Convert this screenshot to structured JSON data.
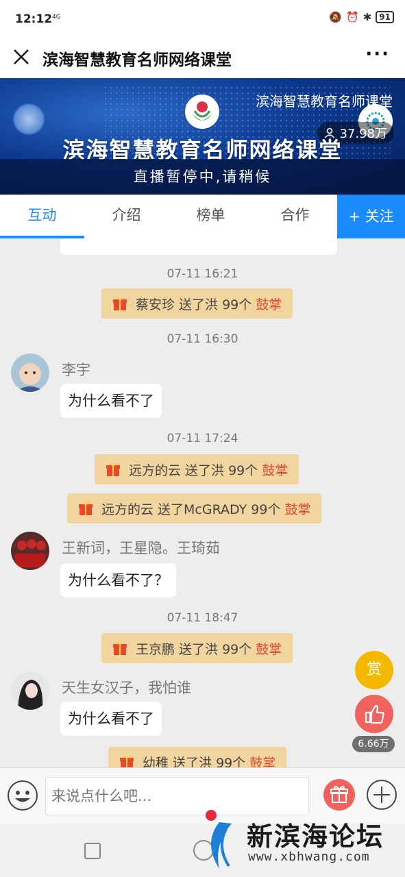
{
  "status_bar": {
    "time": "12:12",
    "signal": "4G",
    "battery": "91"
  },
  "title_bar": {
    "title": "滨海智慧教育名师网络课堂",
    "more": "···"
  },
  "banner": {
    "top_right_text": "滨海智慧教育名师课堂",
    "big_title": "滨海智慧教育名师网络课堂",
    "viewers": "37.98万",
    "paused_text": "直播暂停中,请稍候"
  },
  "tabs": [
    {
      "label": "互动",
      "active": true
    },
    {
      "label": "介绍",
      "active": false
    },
    {
      "label": "榜单",
      "active": false
    },
    {
      "label": "合作",
      "active": false
    }
  ],
  "follow_label": "+ 关注",
  "chat": {
    "timestamps": [
      "07-11 16:21",
      "07-11 16:30",
      "07-11 17:24",
      "07-11 18:47"
    ],
    "gifts": [
      {
        "text": "蔡安珍 送了洪 99个",
        "clap": "鼓掌"
      },
      {
        "text": "远方的云 送了洪 99个",
        "clap": "鼓掌"
      },
      {
        "text": "远方的云 送了McGRADY 99个",
        "clap": "鼓掌"
      },
      {
        "text": "王京鹏 送了洪 99个",
        "clap": "鼓掌"
      },
      {
        "text": "幼稚 送了洪 99个",
        "clap": "鼓掌"
      }
    ],
    "messages": [
      {
        "user": "李宇",
        "text": "为什么看不了"
      },
      {
        "user": "王新词，王星隐。王琦茹",
        "text": "为什么看不了？"
      },
      {
        "user": "天生女汉子，我怕谁",
        "text": "为什么看不了"
      }
    ]
  },
  "floating": {
    "reward_label": "赏",
    "like_count": "6.66万"
  },
  "input": {
    "placeholder": "来说点什么吧..."
  },
  "watermark": {
    "text": "新滨海论坛",
    "url": "www.xbhwang.com"
  },
  "colors": {
    "accent": "#1a8cff",
    "gift_bg": "#f2d59e",
    "clap": "#e64a2e",
    "reward": "#f5b800",
    "like": "#f0625d"
  }
}
